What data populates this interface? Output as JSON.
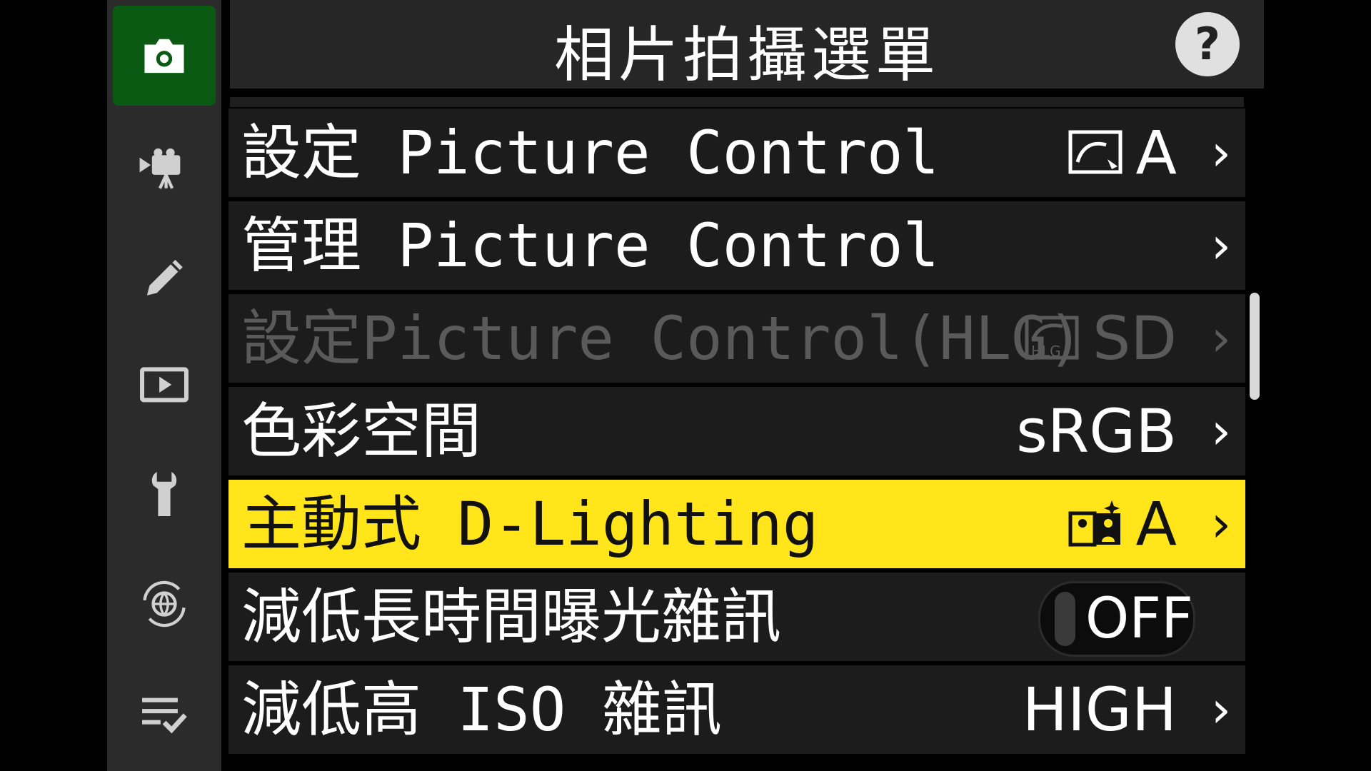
{
  "title": "相片拍攝選單",
  "help_label": "?",
  "sidebar": {
    "items": [
      {
        "name": "photo-shooting",
        "icon": "camera-icon",
        "active": true
      },
      {
        "name": "movie-recording",
        "icon": "movie-camera-icon",
        "active": false
      },
      {
        "name": "custom-settings",
        "icon": "pencil-icon",
        "active": false
      },
      {
        "name": "playback",
        "icon": "playback-icon",
        "active": false
      },
      {
        "name": "setup",
        "icon": "wrench-icon",
        "active": false
      },
      {
        "name": "network",
        "icon": "network-icon",
        "active": false
      },
      {
        "name": "my-menu",
        "icon": "my-menu-icon",
        "active": false
      }
    ]
  },
  "menu": {
    "items": [
      {
        "label": "設定 Picture Control",
        "value": "A",
        "value_icon": "picture-control-icon"
      },
      {
        "label": "管理 Picture Control",
        "value": ""
      },
      {
        "label": "設定Picture Control(HLG)",
        "value": "SD",
        "value_icon": "picture-control-hlg-icon",
        "disabled": true
      },
      {
        "label": "色彩空間",
        "value": "sRGB"
      },
      {
        "label": "主動式 D-Lighting",
        "value": "A",
        "value_icon": "active-d-lighting-icon",
        "selected": true
      },
      {
        "label": "減低長時間曝光雜訊",
        "toggle": "OFF"
      },
      {
        "label": "減低高 ISO 雜訊",
        "value": "HIGH"
      }
    ]
  },
  "colors": {
    "selected_row": "#ffe51a",
    "active_tab": "#0a5a14",
    "row_bg": "#1c1c1c"
  }
}
